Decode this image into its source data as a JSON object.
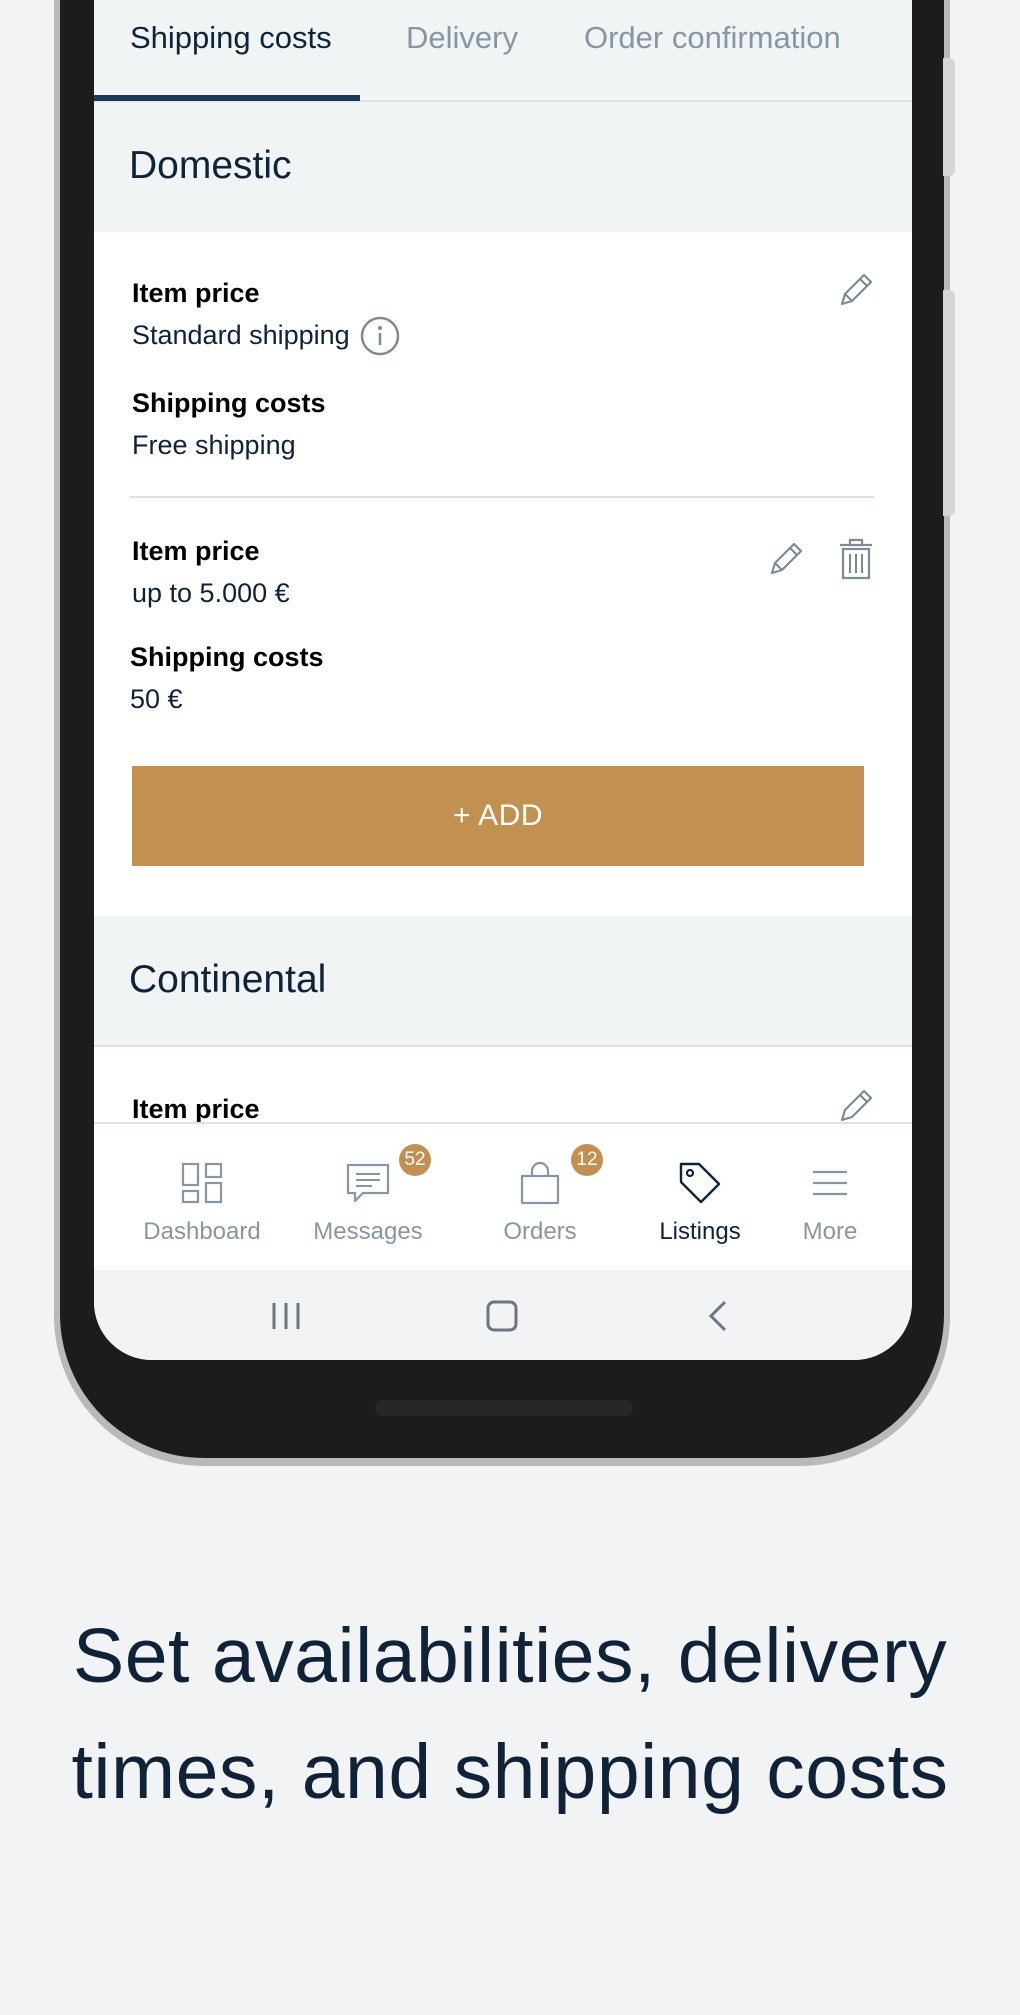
{
  "tabs": [
    {
      "label": "Shipping costs",
      "active": true
    },
    {
      "label": "Delivery",
      "active": false
    },
    {
      "label": "Order confirmation",
      "active": false
    }
  ],
  "sections": {
    "domestic": {
      "title": "Domestic",
      "rows": [
        {
          "price_label": "Item price",
          "price_value": "Standard shipping",
          "cost_label": "Shipping costs",
          "cost_value": "Free shipping"
        },
        {
          "price_label": "Item price",
          "price_value": "up to 5.000 €",
          "cost_label": "Shipping costs",
          "cost_value": "50 €"
        }
      ],
      "add_label": "+ ADD"
    },
    "continental": {
      "title": "Continental",
      "rows": [
        {
          "price_label": "Item price"
        }
      ]
    }
  },
  "nav": {
    "items": [
      {
        "label": "Dashboard",
        "icon": "dashboard-icon"
      },
      {
        "label": "Messages",
        "icon": "messages-icon",
        "badge": "52"
      },
      {
        "label": "Orders",
        "icon": "orders-bag-icon",
        "badge": "12"
      },
      {
        "label": "Listings",
        "icon": "tag-icon",
        "active": true
      },
      {
        "label": "More",
        "icon": "menu-icon"
      }
    ]
  },
  "colors": {
    "accent": "#c29152",
    "navy": "#0f2238",
    "muted": "#8796a4",
    "tab_underline": "#1b3a55"
  },
  "caption": {
    "line1": "Set availabilities, delivery",
    "line2": "times, and shipping costs"
  }
}
